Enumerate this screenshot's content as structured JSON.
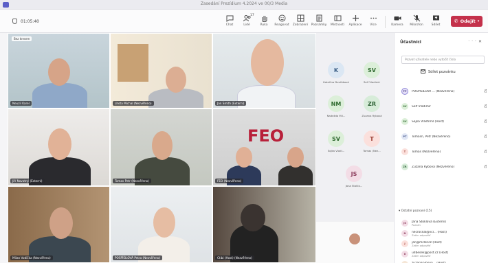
{
  "window": {
    "title": "Zasedání Prezídium 4.2024 ve 00/3 Media"
  },
  "toolbar": {
    "timer": "01:05:40",
    "tools": [
      {
        "label": "Chat",
        "icon": "chat-icon"
      },
      {
        "label": "Lidé",
        "icon": "people-icon",
        "badge": "17"
      },
      {
        "label": "Ruka",
        "icon": "hand-icon"
      },
      {
        "label": "Reagovat",
        "icon": "emoji-icon"
      },
      {
        "label": "Zobrazení",
        "icon": "grid-icon"
      },
      {
        "label": "Poznámky",
        "icon": "notes-icon"
      },
      {
        "label": "Místnosti",
        "icon": "rooms-icon"
      },
      {
        "label": "Aplikace",
        "icon": "apps-icon"
      },
      {
        "label": "Více",
        "icon": "more-icon"
      }
    ],
    "camera": "Kamera",
    "mic": "Mikrofon",
    "share": "Sdílet",
    "leave": "Odejít"
  },
  "tiles": [
    {
      "name": "Neuzil Karel",
      "stamp": "Bez kresem"
    },
    {
      "name": "Lhota Michal (Nezvěřeno)"
    },
    {
      "name": "Jan Smith (Externí)"
    },
    {
      "name": "Jiří Novotný (Externí)"
    },
    {
      "name": "Tomas Petr (Nezvěřeno)"
    },
    {
      "name": "FEO (Nezvěřeno)",
      "logo": "FEO"
    },
    {
      "name": "Milan Vodička (Nezvěřeno)"
    },
    {
      "name": "POSPÍŠILOVÁ Petra (Nezvěřeno)"
    },
    {
      "name": "Ctibi (Host) (Nezvěřeno)"
    }
  ],
  "avatars": [
    {
      "initials": "K",
      "label": "Kateřina Dvořáková",
      "color": "#dbe7f3",
      "text": "#3b5f85"
    },
    {
      "initials": "SV",
      "label": "Self Vladimír",
      "color": "#dcefd9",
      "text": "#2f6a2f"
    },
    {
      "initials": "NM",
      "label": "Nadežda Mil...",
      "color": "#dcefd9",
      "text": "#2f6a2f"
    },
    {
      "initials": "ZR",
      "label": "Zuzana Rybová",
      "color": "#d7ecd9",
      "text": "#2a5f32"
    },
    {
      "initials": "SV",
      "label": "Sojka Vladi...",
      "color": "#dcefd9",
      "text": "#2f6a2f"
    },
    {
      "initials": "T",
      "label": "Tomas (Nez...",
      "color": "#fbe0dc",
      "text": "#9a3a2f"
    },
    {
      "initials": "JS",
      "label": "Jana Stoklo...",
      "color": "#f3dde6",
      "text": "#8a3a5a"
    }
  ],
  "panel": {
    "title": "Účastníci",
    "search_placeholder": "Pozvat uživatele nebo vytočit číslo",
    "share_invite": "Sdílet pozvánku",
    "participants": [
      {
        "initials": "PP",
        "name": "POSPÍŠILOVÁ ... (Nezvěřeno)",
        "color": "#e4dff6",
        "text": "#4b3f8a"
      },
      {
        "initials": "SV",
        "name": "Self Vladimír",
        "color": "#dcefd9",
        "text": "#2f6a2f"
      },
      {
        "initials": "SV",
        "name": "Sojka Vlastimil (Host)",
        "color": "#dcefd9",
        "text": "#2f6a2f"
      },
      {
        "initials": "PT",
        "name": "Tomasn, Petr (Nezvěřeno)",
        "color": "#e1e7f5",
        "text": "#3b4f85"
      },
      {
        "initials": "T",
        "name": "Tomas (Nezvěřeno)",
        "color": "#fbe0dc",
        "text": "#9a3a2f"
      },
      {
        "initials": "ZR",
        "name": "Zuzana Rybová (Nezvěřeno)",
        "color": "#d7ecd9",
        "text": "#2a5f32"
      }
    ],
    "section": "Ostatní pozvaní (15)",
    "invited": [
      {
        "initials": "JS",
        "name": "Jana Stoklová (Externí)",
        "sub": "Pozván",
        "color": "#f3dde6",
        "text": "#8a3a5a"
      },
      {
        "initials": "N",
        "name": "necrosnal@vcl... (Host)",
        "sub": "Zatím odpověď",
        "color": "#f3dde6",
        "text": "#8a3a5a"
      },
      {
        "initials": "J",
        "name": "jan@mcllincz (Host)",
        "sub": "Zatím odpověď",
        "color": "#fbe0dc",
        "text": "#9a3a2f"
      },
      {
        "initials": "U",
        "name": "udbesek@post.cz (Host)",
        "sub": "Zatím odpověď",
        "color": "#f3dde6",
        "text": "#8a3a5a"
      },
      {
        "initials": "Z",
        "name": "zuzanarybova... (Host)",
        "sub": "Zatím odpověď",
        "color": "#f5e6d6",
        "text": "#8a5a2a"
      }
    ]
  }
}
